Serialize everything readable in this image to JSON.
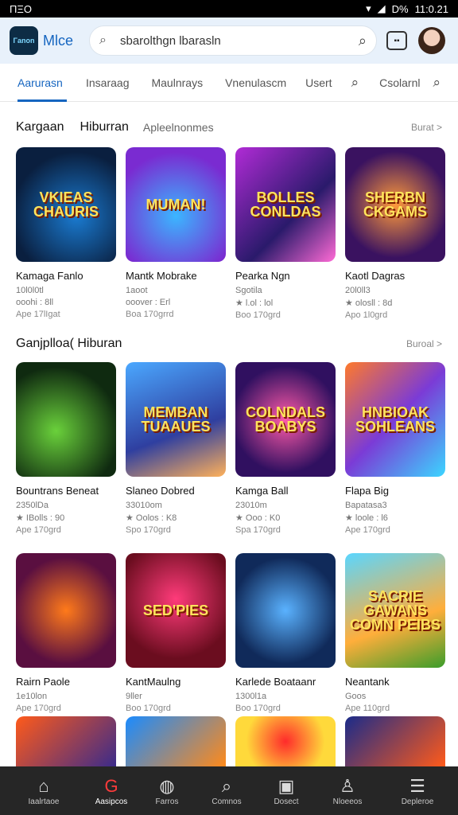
{
  "status": {
    "time_left": "ΠΞΟ",
    "time_right": "11:0.21",
    "battery": "D%"
  },
  "header": {
    "logo_text": "Γanon",
    "brand": "Mlce",
    "search_text": "sbarolthgn lbarasln"
  },
  "tabs": [
    {
      "label": "Aarurasn"
    },
    {
      "label": "Insaraag"
    },
    {
      "label": "Maulnrays"
    },
    {
      "label": "Vnenulascm"
    },
    {
      "label": "Usert"
    },
    {
      "label": "Csolarnl"
    }
  ],
  "section1": {
    "h1": "Kargaan",
    "h2": "Hiburran",
    "h3": "Apleelnonmes",
    "more": "Burat >"
  },
  "section2": {
    "h1": "Ganjplloa( Hiburan",
    "more": "Buroal >"
  },
  "cards": [
    {
      "art": "VKIEAS CHAURIS",
      "title": "Kamaga Fanlo",
      "m1": "10l0l0tl",
      "m2": "ooohi : 8ll",
      "m3": "Ape 17lIgat"
    },
    {
      "art": "MUMAN!",
      "title": "Mantk Mobrake",
      "m2": "ooover : Erl",
      "m1": "1aoot",
      "m3": "Boa 170grrd"
    },
    {
      "art": "BOLLES CONLDAS",
      "title": "Pearka Ngn",
      "m1": "Sgotila",
      "m2": "★ l.ol : lol",
      "m3": "Boo 170grd"
    },
    {
      "art": "SHERBN CKGAMS",
      "title": "Kaotl Dagras",
      "m1": "20l0ll3",
      "m2": "★ olosll : 8d",
      "m3": "Apo 1l0grd"
    },
    {
      "art": "",
      "title": "Bountrans Beneat",
      "m1": "2350lDa",
      "m2": "★ IBolls : 90",
      "m3": "Ape 170grd"
    },
    {
      "art": "MEMBAN TUAAUES",
      "title": "Slaneo Dobred",
      "m1": "33010om",
      "m2": "★ Oolos : K8",
      "m3": "Spo 170grd"
    },
    {
      "art": "COLNDALS BOABYS",
      "title": "Kamga Ball",
      "m1": "23010m",
      "m2": "★ Ooo : K0",
      "m3": "Spa 170grd"
    },
    {
      "art": "HNBIOAK SOHLEANS",
      "title": "Flapa Big",
      "m1": "Bapatasa3",
      "m2": "★ loole : l6",
      "m3": "Ape 170grd"
    },
    {
      "art": "",
      "title": "Rairn Paole",
      "m1": "1e10lon",
      "m3": "Ape 170grd",
      "m2": ""
    },
    {
      "art": "SED'PIES",
      "title": "KantMaulng",
      "m1": "9ller",
      "m3": "Boo 170grd",
      "m2": ""
    },
    {
      "art": "",
      "title": "Karlede Boataanr",
      "m1": "1300l1a",
      "m3": "Boo 170grd",
      "m2": ""
    },
    {
      "art": "SACRIE GAWANS COMN PEIBS",
      "title": "Neantank",
      "m1": "Goos",
      "m3": "Ape 110grd",
      "m2": ""
    },
    {
      "art": "",
      "title": "",
      "m1": "",
      "m2": "",
      "m3": ""
    },
    {
      "art": "",
      "title": "",
      "m1": "",
      "m2": "",
      "m3": ""
    },
    {
      "art": "",
      "title": "",
      "m1": "",
      "m2": "",
      "m3": ""
    },
    {
      "art": "",
      "title": "",
      "m1": "",
      "m2": "",
      "m3": ""
    }
  ],
  "bottomnav": [
    {
      "label": "Iaalrtaoe",
      "icon": "home-icon"
    },
    {
      "label": "Aasipcos",
      "icon": "games-icon"
    },
    {
      "label": "Farros",
      "icon": "circle-icon"
    },
    {
      "label": "Comnos",
      "icon": "search-icon"
    },
    {
      "label": "Dosect",
      "icon": "square-icon"
    },
    {
      "label": "Nloeeos",
      "icon": "person-icon"
    },
    {
      "label": "Depleroe",
      "icon": "list-icon"
    }
  ],
  "colors": {
    "accent": "#1565c0",
    "nav_bg": "#262626",
    "header_bg": "#e8f1fb"
  }
}
